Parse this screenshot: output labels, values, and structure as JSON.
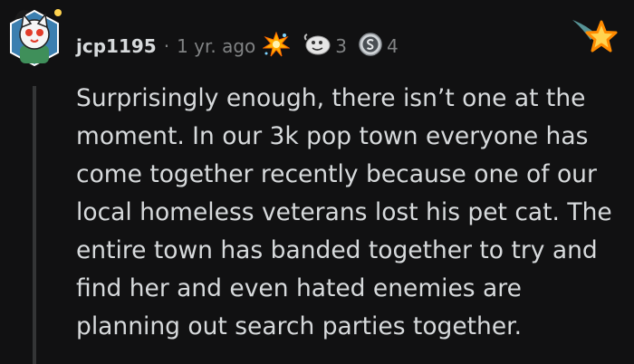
{
  "comment": {
    "username": "jcp1195",
    "separator": "·",
    "timestamp": "1 yr. ago",
    "body": "Surprisingly enough, there isn’t one at the moment. In our 3k pop town everyone has come together recently because one of our local homeless veterans lost his pet cat. The entire town has banded together to try and find her and even hated enemies are planning out search parties together.",
    "awards": [
      {
        "icon": "explosion-award-icon",
        "count": ""
      },
      {
        "icon": "helpful-award-icon",
        "count": "3"
      },
      {
        "icon": "silver-award-icon",
        "count": "4"
      }
    ]
  },
  "colors": {
    "background": "#111112",
    "text": "#d7dadc",
    "meta": "#818384",
    "thread_line": "#343536",
    "star_orange": "#ff8a00",
    "star_yellow": "#ffd34f"
  }
}
